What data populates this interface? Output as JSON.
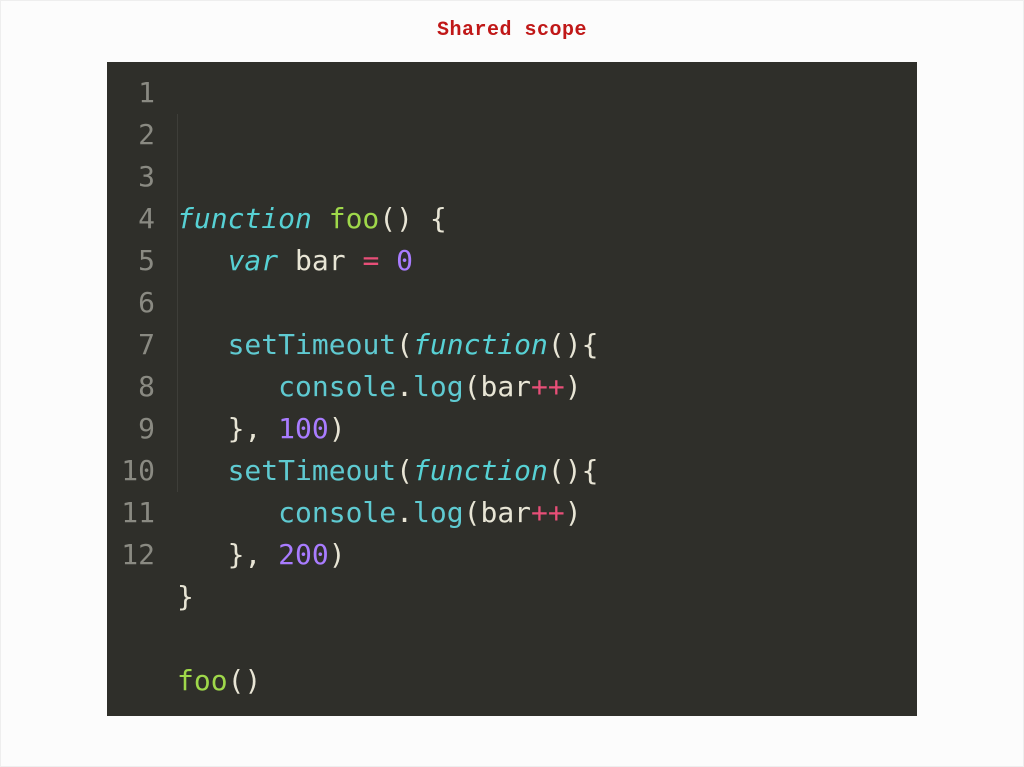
{
  "title": "Shared scope",
  "editor": {
    "lineNumbers": [
      "1",
      "2",
      "3",
      "4",
      "5",
      "6",
      "7",
      "8",
      "9",
      "10",
      "11",
      "12"
    ],
    "lines": [
      [
        {
          "t": "function",
          "c": "tk-keyword"
        },
        {
          "t": " ",
          "c": ""
        },
        {
          "t": "foo",
          "c": "tk-funcname"
        },
        {
          "t": "(",
          "c": "tk-paren"
        },
        {
          "t": ")",
          "c": "tk-paren"
        },
        {
          "t": " ",
          "c": ""
        },
        {
          "t": "{",
          "c": "tk-brace"
        }
      ],
      [
        {
          "t": "   ",
          "c": ""
        },
        {
          "t": "var",
          "c": "tk-keyword"
        },
        {
          "t": " ",
          "c": ""
        },
        {
          "t": "bar",
          "c": "tk-var"
        },
        {
          "t": " ",
          "c": ""
        },
        {
          "t": "=",
          "c": "tk-op"
        },
        {
          "t": " ",
          "c": ""
        },
        {
          "t": "0",
          "c": "tk-number"
        }
      ],
      [],
      [
        {
          "t": "   ",
          "c": ""
        },
        {
          "t": "setTimeout",
          "c": "tk-builtin"
        },
        {
          "t": "(",
          "c": "tk-paren"
        },
        {
          "t": "function",
          "c": "tk-keyword"
        },
        {
          "t": "(",
          "c": "tk-paren"
        },
        {
          "t": ")",
          "c": "tk-paren"
        },
        {
          "t": "{",
          "c": "tk-brace"
        }
      ],
      [
        {
          "t": "      ",
          "c": ""
        },
        {
          "t": "console",
          "c": "tk-builtin"
        },
        {
          "t": ".",
          "c": "tk-dot"
        },
        {
          "t": "log",
          "c": "tk-method"
        },
        {
          "t": "(",
          "c": "tk-paren"
        },
        {
          "t": "bar",
          "c": "tk-var"
        },
        {
          "t": "++",
          "c": "tk-op"
        },
        {
          "t": ")",
          "c": "tk-paren"
        }
      ],
      [
        {
          "t": "   ",
          "c": ""
        },
        {
          "t": "}",
          "c": "tk-brace"
        },
        {
          "t": ",",
          "c": "tk-comma"
        },
        {
          "t": " ",
          "c": ""
        },
        {
          "t": "100",
          "c": "tk-number"
        },
        {
          "t": ")",
          "c": "tk-paren"
        }
      ],
      [
        {
          "t": "   ",
          "c": ""
        },
        {
          "t": "setTimeout",
          "c": "tk-builtin"
        },
        {
          "t": "(",
          "c": "tk-paren"
        },
        {
          "t": "function",
          "c": "tk-keyword"
        },
        {
          "t": "(",
          "c": "tk-paren"
        },
        {
          "t": ")",
          "c": "tk-paren"
        },
        {
          "t": "{",
          "c": "tk-brace"
        }
      ],
      [
        {
          "t": "      ",
          "c": ""
        },
        {
          "t": "console",
          "c": "tk-builtin"
        },
        {
          "t": ".",
          "c": "tk-dot"
        },
        {
          "t": "log",
          "c": "tk-method"
        },
        {
          "t": "(",
          "c": "tk-paren"
        },
        {
          "t": "bar",
          "c": "tk-var"
        },
        {
          "t": "++",
          "c": "tk-op"
        },
        {
          "t": ")",
          "c": "tk-paren"
        }
      ],
      [
        {
          "t": "   ",
          "c": ""
        },
        {
          "t": "}",
          "c": "tk-brace"
        },
        {
          "t": ",",
          "c": "tk-comma"
        },
        {
          "t": " ",
          "c": ""
        },
        {
          "t": "200",
          "c": "tk-number"
        },
        {
          "t": ")",
          "c": "tk-paren"
        }
      ],
      [
        {
          "t": "}",
          "c": "tk-brace"
        }
      ],
      [],
      [
        {
          "t": "foo",
          "c": "tk-funcname"
        },
        {
          "t": "(",
          "c": "tk-paren"
        },
        {
          "t": ")",
          "c": "tk-paren"
        }
      ]
    ]
  }
}
